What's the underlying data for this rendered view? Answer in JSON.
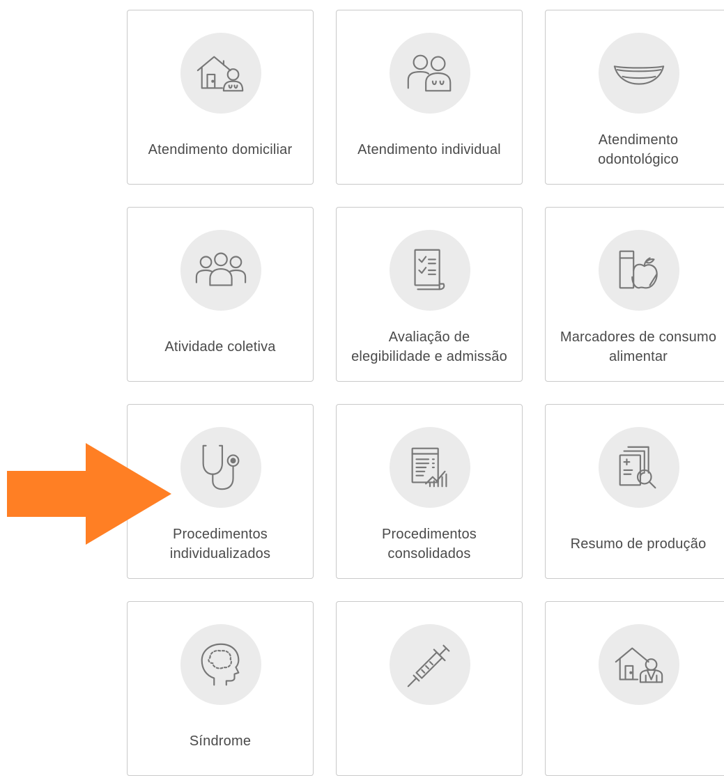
{
  "cards": [
    {
      "label": "Atendimento domiciliar",
      "icon": "home-care-icon"
    },
    {
      "label": "Atendimento individual",
      "icon": "individual-care-icon"
    },
    {
      "label": "Atendimento odontológico",
      "icon": "dental-smile-icon"
    },
    {
      "label": "Atividade coletiva",
      "icon": "group-activity-icon"
    },
    {
      "label": "Avaliação de elegibilidade e admissão",
      "icon": "checklist-icon"
    },
    {
      "label": "Marcadores de consumo alimentar",
      "icon": "food-consumption-icon"
    },
    {
      "label": "Procedimentos individualizados",
      "icon": "stethoscope-icon"
    },
    {
      "label": "Procedimentos consolidados",
      "icon": "report-chart-icon"
    },
    {
      "label": "Resumo de produção",
      "icon": "document-search-icon"
    },
    {
      "label": "Síndrome",
      "icon": "head-brain-icon"
    },
    {
      "label": "",
      "icon": "syringe-icon"
    },
    {
      "label": "",
      "icon": "home-visit-icon"
    }
  ],
  "colors": {
    "arrow": "#ff7f24",
    "card_border": "#c9c9c9",
    "icon_bg": "#ebebeb",
    "icon_stroke": "#777777",
    "text": "#4a4a4a"
  }
}
